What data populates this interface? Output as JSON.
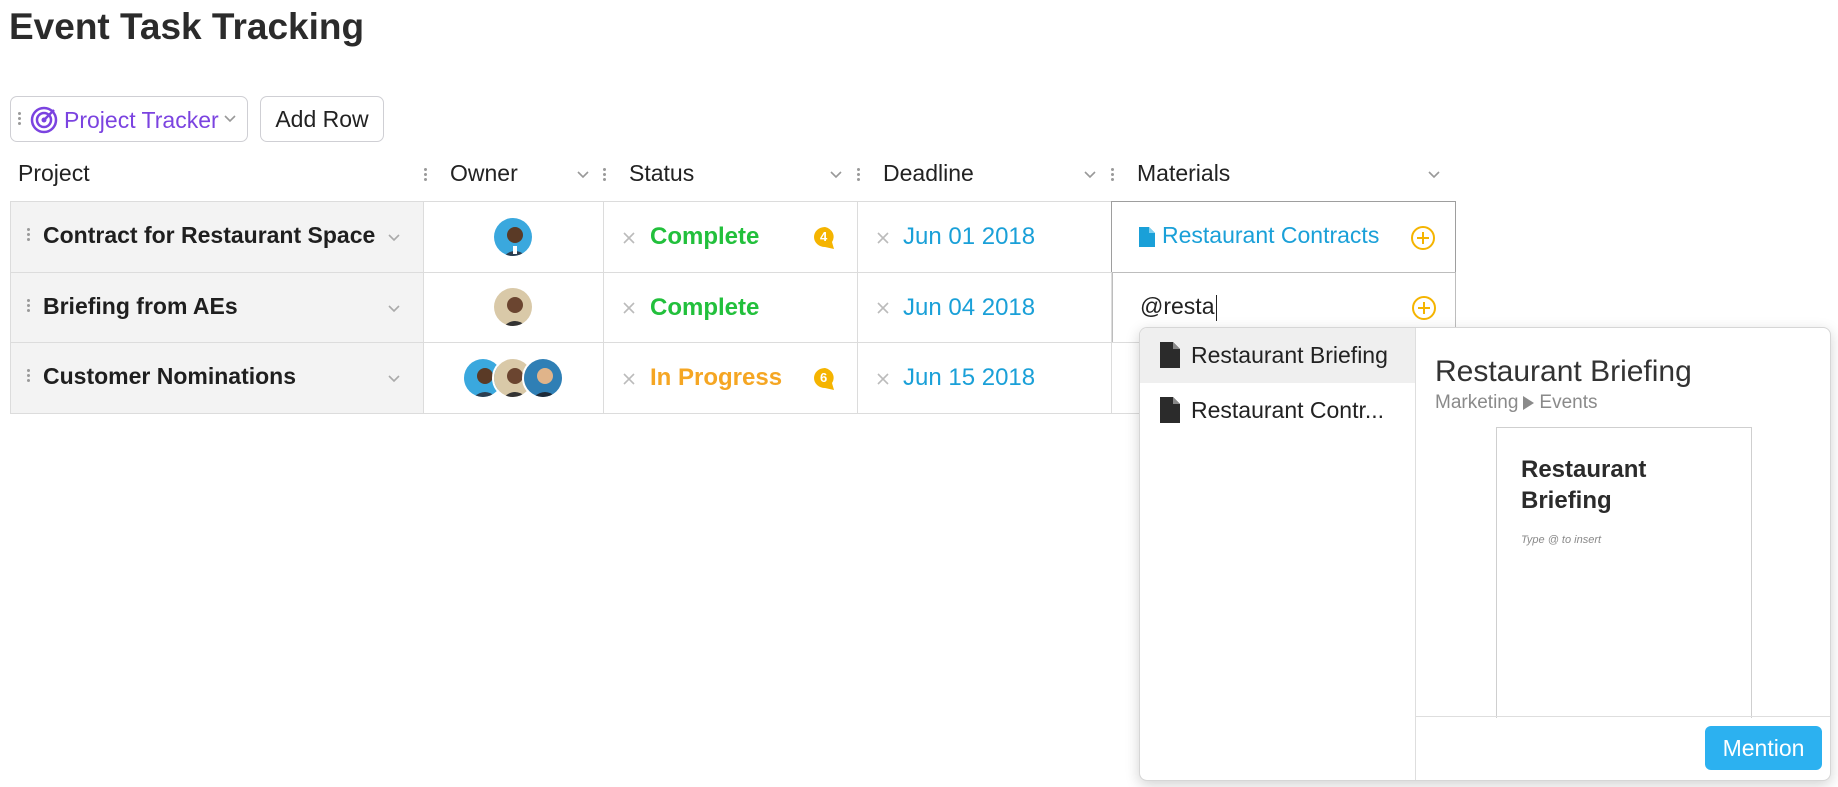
{
  "page": {
    "title": "Event Task Tracking"
  },
  "toolbar": {
    "tracker_label": "Project Tracker",
    "add_row_label": "Add Row",
    "accent_color": "#7b43e0"
  },
  "columns": {
    "project": "Project",
    "owner": "Owner",
    "status": "Status",
    "deadline": "Deadline",
    "materials": "Materials"
  },
  "rows": [
    {
      "project": "Contract for Restaurant Space",
      "status": "Complete",
      "status_color": "#22c03c",
      "comments": "4",
      "deadline": "Jun 01 2018",
      "material": "Restaurant Contracts"
    },
    {
      "project": "Briefing from AEs",
      "status": "Complete",
      "status_color": "#22c03c",
      "comments": "",
      "deadline": "Jun 04 2018",
      "material_input": "@resta"
    },
    {
      "project": "Customer Nominations",
      "status": "In Progress",
      "status_color": "#f5a623",
      "comments": "6",
      "deadline": "Jun 15 2018",
      "material": ""
    }
  ],
  "mention_popup": {
    "items": [
      "Restaurant Briefing",
      "Restaurant Contr..."
    ],
    "preview": {
      "title": "Restaurant Briefing",
      "path_parent": "Marketing",
      "path_child": "Events",
      "doc_title": "Restaurant Briefing",
      "doc_hint": "Type @ to insert"
    },
    "mention_label": "Mention"
  }
}
